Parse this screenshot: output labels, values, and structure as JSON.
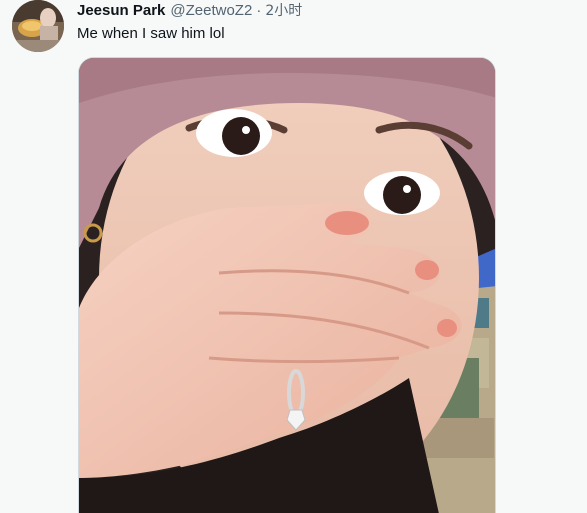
{
  "tweet": {
    "display_name": "Jeesun Park",
    "handle": "@ZeetwoZ2",
    "separator": "·",
    "timestamp": "2小时",
    "text": "Me when I saw him lol"
  },
  "media": {
    "kind": "photo",
    "icon": "tweet-photo"
  },
  "colors": {
    "text_primary": "#0f1419",
    "text_secondary": "#536471",
    "border": "#cfd9de",
    "background": "#f7f9f9"
  }
}
